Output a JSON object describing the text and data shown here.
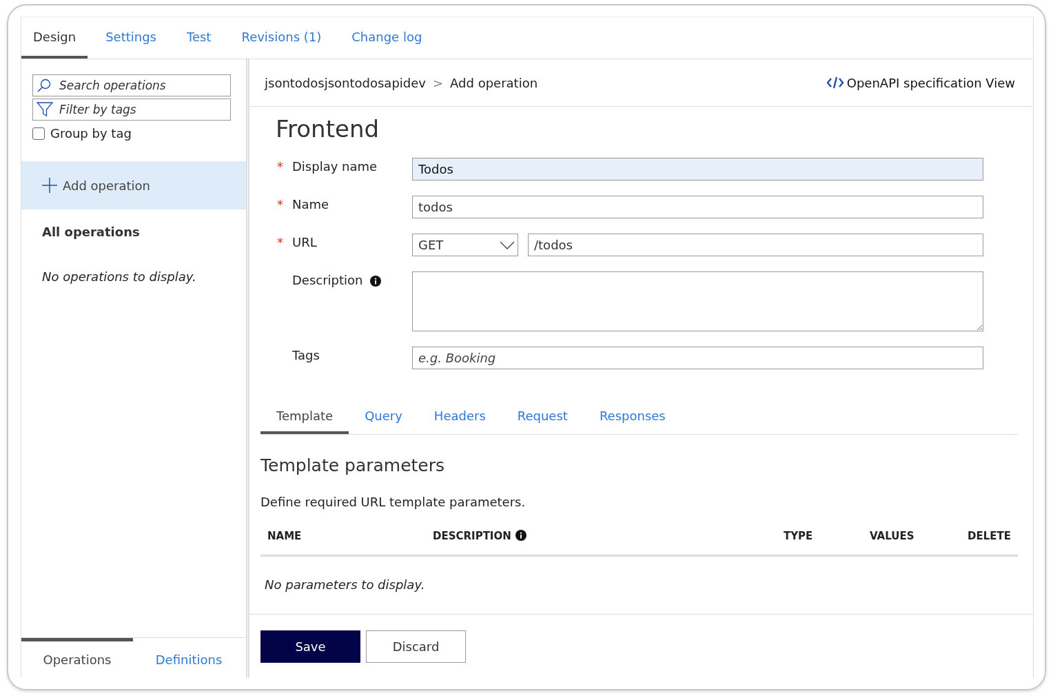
{
  "tabs": [
    {
      "label": "Design",
      "selected": true
    },
    {
      "label": "Settings",
      "selected": false
    },
    {
      "label": "Test",
      "selected": false
    },
    {
      "label": "Revisions (1)",
      "selected": false
    },
    {
      "label": "Change log",
      "selected": false
    }
  ],
  "sidebar": {
    "search": {
      "placeholder": "Search operations"
    },
    "filter": {
      "placeholder": "Filter by tags"
    },
    "group_by_tag": {
      "label": "Group by tag",
      "checked": false
    },
    "add_operation": {
      "label": "Add operation",
      "selected": true
    },
    "heading": "All operations",
    "empty_text": "No operations to display.",
    "bottom_tabs": [
      {
        "label": "Operations",
        "selected": true
      },
      {
        "label": "Definitions",
        "selected": false
      }
    ]
  },
  "breadcrumb": [
    "jsontodosjsontodosapidev",
    "Add operation"
  ],
  "breadcrumb_separator": ">",
  "spec_link": "OpenAPI specification View",
  "form": {
    "title": "Frontend",
    "required_marker": "*",
    "fields": [
      {
        "kind": "text",
        "label": "Display name",
        "required": true,
        "info": false,
        "value": "Todos",
        "focused": true
      },
      {
        "kind": "text",
        "label": "Name",
        "required": true,
        "info": false,
        "value": "todos",
        "focused": false
      },
      {
        "kind": "url",
        "label": "URL",
        "required": true,
        "info": false,
        "method": "GET",
        "value": "/todos",
        "focused": false
      },
      {
        "kind": "textarea",
        "label": "Description",
        "required": false,
        "info": true,
        "focused": false
      },
      {
        "kind": "text",
        "label": "Tags",
        "required": false,
        "info": false,
        "placeholder": "e.g. Booking",
        "focused": false
      }
    ]
  },
  "subtabs": [
    {
      "label": "Template",
      "selected": true
    },
    {
      "label": "Query",
      "selected": false
    },
    {
      "label": "Headers",
      "selected": false
    },
    {
      "label": "Request",
      "selected": false
    },
    {
      "label": "Responses",
      "selected": false
    }
  ],
  "section": {
    "title": "Template parameters",
    "description": "Define required URL template parameters.",
    "table": {
      "columns": [
        {
          "label": "NAME",
          "info": false
        },
        {
          "label": "DESCRIPTION",
          "info": true
        },
        {
          "label": "TYPE",
          "info": false
        },
        {
          "label": "VALUES",
          "info": false
        },
        {
          "label": "DELETE",
          "info": false
        }
      ],
      "empty_text": "No parameters to display."
    }
  },
  "buttons": [
    {
      "label": "Save",
      "kind": "primary"
    },
    {
      "label": "Discard",
      "kind": "secondary"
    }
  ]
}
